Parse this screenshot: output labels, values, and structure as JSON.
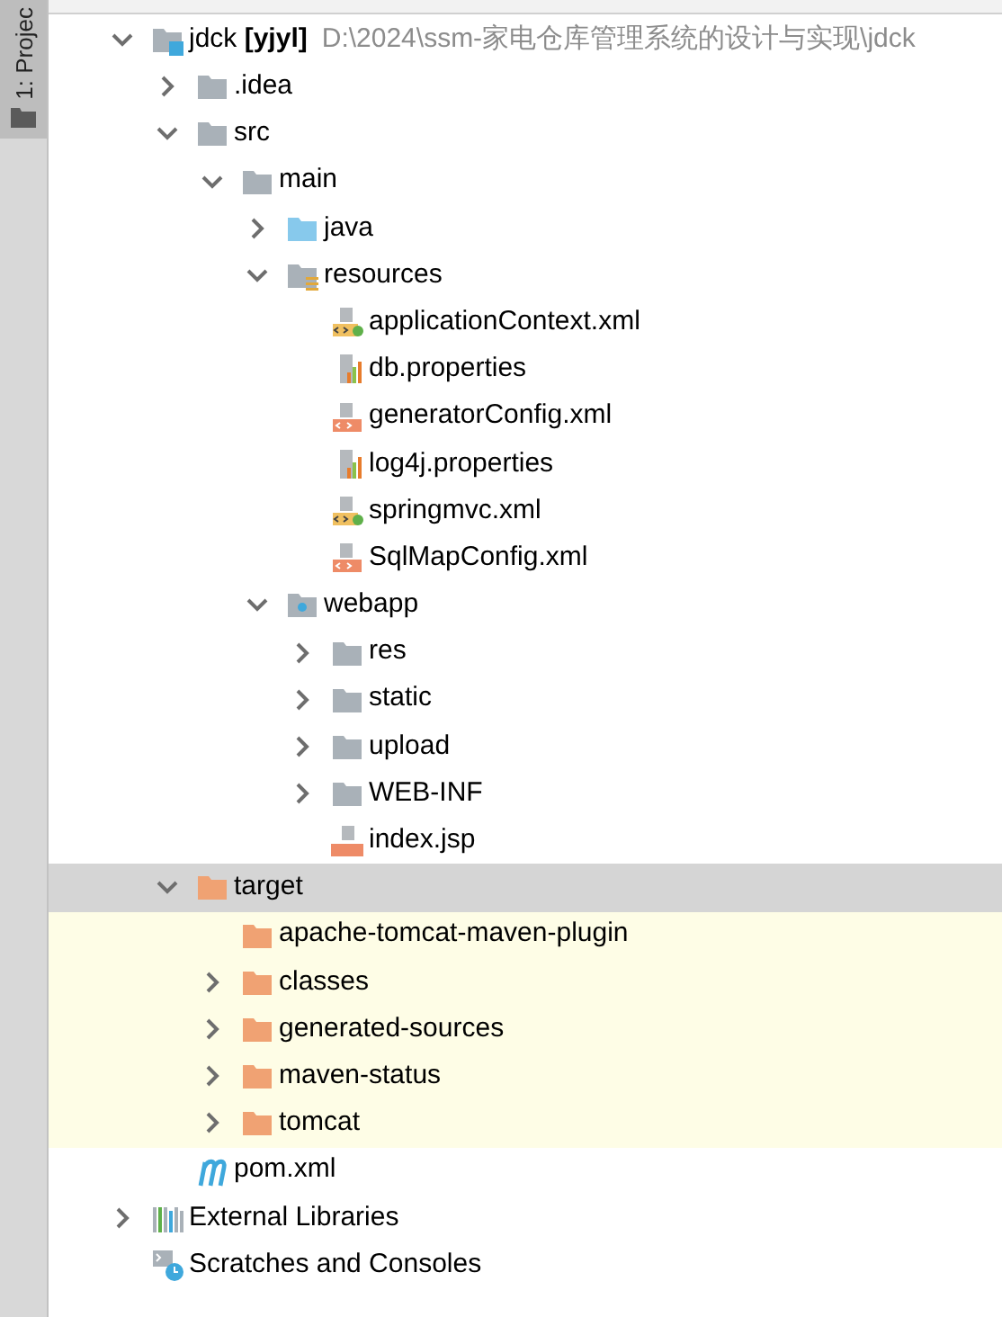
{
  "side_tab": {
    "label": "1: Projec"
  },
  "tree": [
    {
      "kind": "module",
      "label": "jdck **[yjyl]**",
      "path": "D:\\2024\\ssm-家电仓库管理系统的设计与实现\\jdck",
      "expanded": true,
      "selected": false,
      "children": [
        {
          "kind": "folder",
          "label": ".idea",
          "expanded": false,
          "selected": false
        },
        {
          "kind": "folder",
          "label": "src",
          "expanded": true,
          "selected": false,
          "children": [
            {
              "kind": "folder",
              "label": "main",
              "expanded": true,
              "selected": false,
              "children": [
                {
                  "kind": "source-folder",
                  "label": "java",
                  "expanded": false,
                  "selected": false
                },
                {
                  "kind": "resources-folder",
                  "label": "resources",
                  "expanded": true,
                  "selected": false,
                  "children": [
                    {
                      "kind": "spring-xml",
                      "label": "applicationContext.xml",
                      "selected": false
                    },
                    {
                      "kind": "properties",
                      "label": "db.properties",
                      "selected": false
                    },
                    {
                      "kind": "xml",
                      "label": "generatorConfig.xml",
                      "selected": false
                    },
                    {
                      "kind": "properties",
                      "label": "log4j.properties",
                      "selected": false
                    },
                    {
                      "kind": "spring-xml",
                      "label": "springmvc.xml",
                      "selected": false
                    },
                    {
                      "kind": "xml",
                      "label": "SqlMapConfig.xml",
                      "selected": false
                    }
                  ]
                },
                {
                  "kind": "web-folder",
                  "label": "webapp",
                  "expanded": true,
                  "selected": false,
                  "children": [
                    {
                      "kind": "folder",
                      "label": "res",
                      "expanded": false,
                      "selected": false
                    },
                    {
                      "kind": "folder",
                      "label": "static",
                      "expanded": false,
                      "selected": false
                    },
                    {
                      "kind": "folder",
                      "label": "upload",
                      "expanded": false,
                      "selected": false
                    },
                    {
                      "kind": "folder",
                      "label": "WEB-INF",
                      "expanded": false,
                      "selected": false
                    },
                    {
                      "kind": "jsp",
                      "label": "index.jsp",
                      "selected": false
                    }
                  ]
                }
              ]
            }
          ]
        },
        {
          "kind": "excluded-folder",
          "label": "target",
          "expanded": true,
          "selected": true,
          "children": [
            {
              "kind": "excluded-folder",
              "label": "apache-tomcat-maven-plugin",
              "selected": false
            },
            {
              "kind": "excluded-folder",
              "label": "classes",
              "expanded": false,
              "selected": false
            },
            {
              "kind": "excluded-folder",
              "label": "generated-sources",
              "expanded": false,
              "selected": false
            },
            {
              "kind": "excluded-folder",
              "label": "maven-status",
              "expanded": false,
              "selected": false
            },
            {
              "kind": "excluded-folder",
              "label": "tomcat",
              "expanded": false,
              "selected": false
            }
          ]
        },
        {
          "kind": "maven",
          "label": "pom.xml",
          "selected": false
        }
      ]
    },
    {
      "kind": "libraries",
      "label": "External Libraries",
      "expanded": false,
      "selected": false
    },
    {
      "kind": "scratches",
      "label": "Scratches and Consoles",
      "selected": false
    }
  ]
}
